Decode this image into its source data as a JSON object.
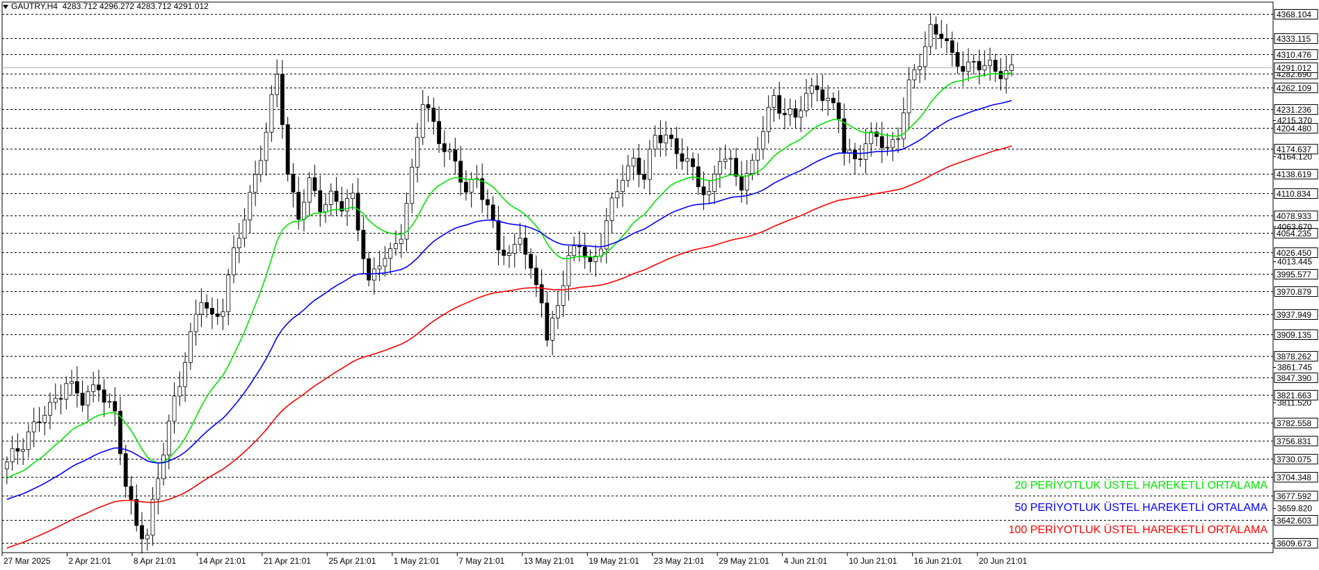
{
  "header": {
    "symbol": "GAUTRY,H4",
    "ohlc": "4283.712 4296.272 4283.712 4291.012"
  },
  "colors": {
    "ema20": "#00e600",
    "ema50": "#0000ff",
    "ema100": "#ff0000",
    "candle": "#000000",
    "grid": "#000000",
    "current_line": "#b0b0b0"
  },
  "legend": [
    {
      "label": "20 PERİYOTLUK ÜSTEL HAREKETLİ ORTALAMA",
      "color": "#00e600"
    },
    {
      "label": "50 PERİYOTLUK ÜSTEL HAREKETLİ ORTALAMA",
      "color": "#0000ff"
    },
    {
      "label": "100 PERİYOTLUK ÜSTEL HAREKETLİ ORTALAMA",
      "color": "#ff0000"
    }
  ],
  "chart_data": {
    "type": "line",
    "title": "GAUTRY,H4",
    "ylim": [
      3596,
      4385
    ],
    "y_levels_boxed": [
      4368.104,
      4333.115,
      4310.476,
      4282.69,
      4262.109,
      4231.236,
      4204.48,
      4174.637,
      4138.619,
      4110.834,
      4078.933,
      4054.235,
      4026.45,
      3995.577,
      3970.879,
      3937.949,
      3909.135,
      3878.262,
      3847.39,
      3821.663,
      3782.558,
      3756.831,
      3730.075,
      3704.348,
      3677.592,
      3642.603,
      3609.673
    ],
    "y_levels_plain": [
      4215.37,
      4164.12,
      4063.67,
      4013.445,
      3861.745,
      3811.52,
      3659.82
    ],
    "current_price": 4291.012,
    "x_tick_labels": [
      "27 Mar 2025",
      "2 Apr 21:01",
      "8 Apr 21:01",
      "14 Apr 21:01",
      "21 Apr 21:01",
      "25 Apr 21:01",
      "1 May 21:01",
      "7 May 21:01",
      "13 May 21:01",
      "19 May 21:01",
      "23 May 21:01",
      "29 May 21:01",
      "4 Jun 21:01",
      "10 Jun 21:01",
      "16 Jun 21:01",
      "20 Jun 21:01"
    ],
    "price_path": [
      [
        0,
        3720
      ],
      [
        4,
        3770
      ],
      [
        8,
        3800
      ],
      [
        11,
        3845
      ],
      [
        14,
        3810
      ],
      [
        17,
        3840
      ],
      [
        20,
        3790
      ],
      [
        22,
        3690
      ],
      [
        24,
        3640
      ],
      [
        26,
        3620
      ],
      [
        28,
        3700
      ],
      [
        31,
        3820
      ],
      [
        34,
        3900
      ],
      [
        36,
        3960
      ],
      [
        38,
        3935
      ],
      [
        40,
        3950
      ],
      [
        42,
        4020
      ],
      [
        44,
        4080
      ],
      [
        46,
        4140
      ],
      [
        48,
        4195
      ],
      [
        50,
        4280
      ],
      [
        51,
        4220
      ],
      [
        52,
        4140
      ],
      [
        54,
        4080
      ],
      [
        56,
        4120
      ],
      [
        58,
        4095
      ],
      [
        60,
        4110
      ],
      [
        62,
        4090
      ],
      [
        64,
        4100
      ],
      [
        66,
        4030
      ],
      [
        67,
        3985
      ],
      [
        69,
        4010
      ],
      [
        71,
        4020
      ],
      [
        73,
        4060
      ],
      [
        75,
        4140
      ],
      [
        77,
        4240
      ],
      [
        79,
        4210
      ],
      [
        81,
        4180
      ],
      [
        83,
        4150
      ],
      [
        85,
        4110
      ],
      [
        87,
        4140
      ],
      [
        89,
        4090
      ],
      [
        91,
        4030
      ],
      [
        93,
        4020
      ],
      [
        95,
        4060
      ],
      [
        97,
        3990
      ],
      [
        99,
        3960
      ],
      [
        100,
        3900
      ],
      [
        102,
        3960
      ],
      [
        104,
        4010
      ],
      [
        106,
        4040
      ],
      [
        108,
        4010
      ],
      [
        110,
        4040
      ],
      [
        112,
        4090
      ],
      [
        114,
        4140
      ],
      [
        116,
        4160
      ],
      [
        118,
        4130
      ],
      [
        120,
        4190
      ],
      [
        122,
        4200
      ],
      [
        124,
        4170
      ],
      [
        126,
        4150
      ],
      [
        128,
        4130
      ],
      [
        130,
        4110
      ],
      [
        132,
        4160
      ],
      [
        134,
        4150
      ],
      [
        136,
        4130
      ],
      [
        138,
        4150
      ],
      [
        140,
        4200
      ],
      [
        142,
        4250
      ],
      [
        144,
        4230
      ],
      [
        146,
        4215
      ],
      [
        148,
        4250
      ],
      [
        150,
        4270
      ],
      [
        152,
        4240
      ],
      [
        154,
        4220
      ],
      [
        155,
        4170
      ],
      [
        157,
        4165
      ],
      [
        159,
        4180
      ],
      [
        161,
        4190
      ],
      [
        163,
        4175
      ],
      [
        165,
        4200
      ],
      [
        167,
        4260
      ],
      [
        169,
        4300
      ],
      [
        171,
        4350
      ],
      [
        173,
        4340
      ],
      [
        175,
        4300
      ],
      [
        177,
        4295
      ],
      [
        179,
        4300
      ],
      [
        181,
        4290
      ],
      [
        183,
        4285
      ],
      [
        185,
        4290
      ],
      [
        186,
        4291
      ]
    ],
    "series": [
      {
        "name": "20 PERİYOTLUK ÜSTEL HAREKETLİ ORTALAMA",
        "values": []
      },
      {
        "name": "50 PERİYOTLUK ÜSTEL HAREKETLİ ORTALAMA",
        "values": []
      },
      {
        "name": "100 PERİYOTLUK ÜSTEL HAREKETLİ ORTALAMA",
        "values": []
      }
    ]
  }
}
